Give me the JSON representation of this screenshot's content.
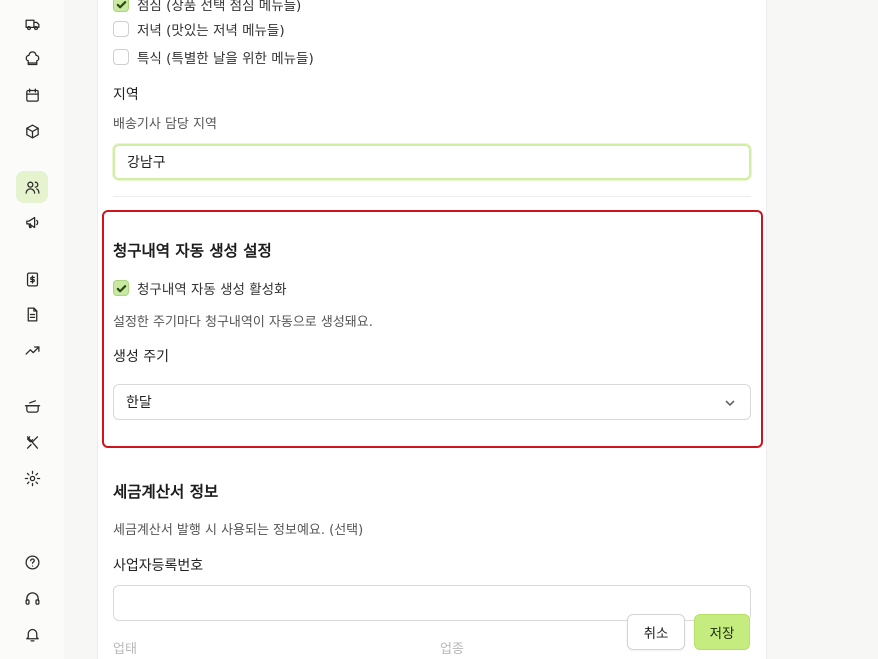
{
  "sidebar": {
    "icons": [
      "truck-icon",
      "chef-hat-icon",
      "calendar-icon",
      "package-icon",
      "users-icon",
      "megaphone-icon",
      "invoice-icon",
      "document-icon",
      "trending-up-icon",
      "cooking-pot-icon",
      "utensils-crossed-icon",
      "settings-icon",
      "help-circle-icon",
      "headphones-icon",
      "bell-icon"
    ],
    "active": "users-icon"
  },
  "menu_checks": [
    {
      "label": "점심 (상품 선택 점심 메뉴들)",
      "checked": true
    },
    {
      "label": "저녁 (맛있는 저녁 메뉴들)",
      "checked": false
    },
    {
      "label": "특식 (특별한 날을 위한 메뉴들)",
      "checked": false
    }
  ],
  "region": {
    "label": "지역",
    "help": "배송기사 담당 지역",
    "value": "강남구"
  },
  "billing": {
    "heading": "청구내역 자동 생성 설정",
    "auto_label": "청구내역 자동 생성 활성화",
    "auto_checked": true,
    "help": "설정한 주기마다 청구내역이 자동으로 생성돼요.",
    "cycle_label": "생성 주기",
    "cycle_value": "한달"
  },
  "tax": {
    "heading": "세금계산서 정보",
    "help": "세금계산서 발행 시 사용되는 정보예요. (선택)",
    "business_number_label": "사업자등록번호",
    "business_number_value": "",
    "business_type_label": "업태",
    "business_item_label": "업종"
  },
  "actions": {
    "cancel": "취소",
    "save": "저장"
  },
  "colors": {
    "accent": "#c5ec7e",
    "highlight": "#d0141d",
    "active_nav": "#e6f3cf"
  }
}
